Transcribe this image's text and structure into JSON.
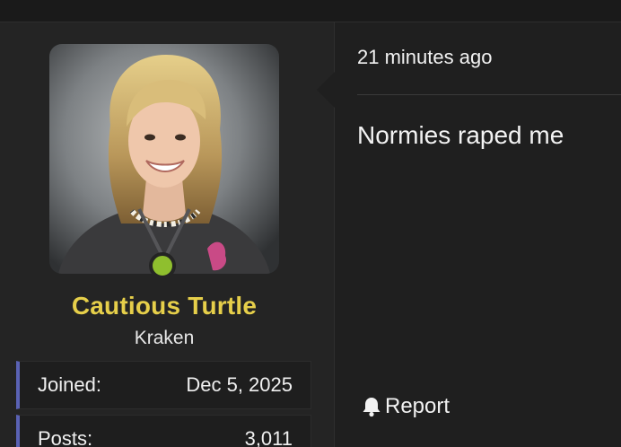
{
  "user": {
    "name": "Cautious Turtle",
    "title": "Kraken",
    "online": true,
    "stats": [
      {
        "label": "Joined:",
        "value": "Dec 5, 2025"
      },
      {
        "label": "Posts:",
        "value": "3,011"
      }
    ]
  },
  "post": {
    "timestamp": "21 minutes ago",
    "body": "Normies raped me",
    "report_label": "Report"
  },
  "colors": {
    "username": "#e6cf4a",
    "online_dot": "#8fbf2e",
    "stat_accent": "#5a62b4"
  },
  "icons": {
    "report": "bell-icon"
  }
}
